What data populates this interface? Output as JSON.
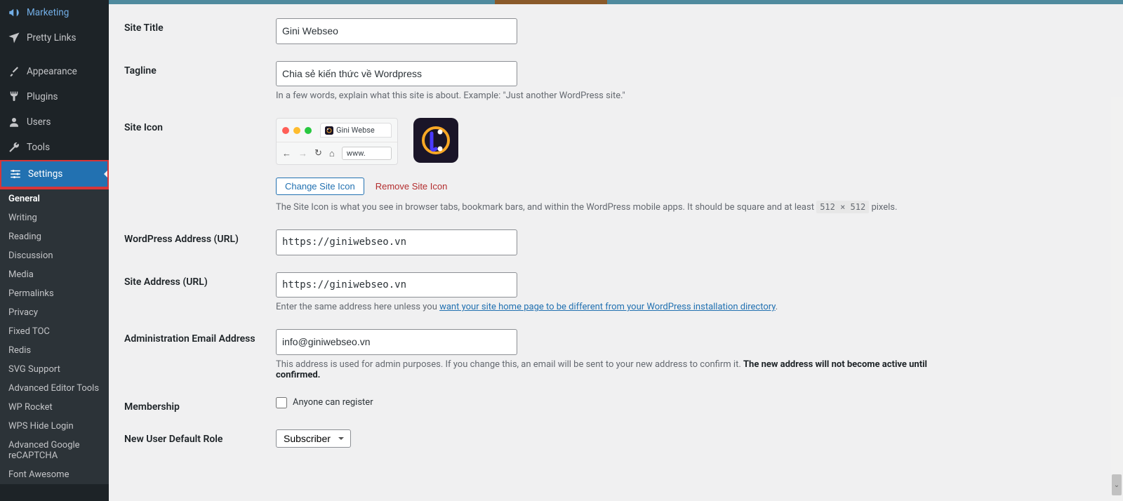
{
  "sidebar": {
    "main": [
      {
        "icon": "megaphone",
        "label": "Marketing"
      },
      {
        "icon": "star",
        "label": "Pretty Links"
      },
      {
        "icon": "brush",
        "label": "Appearance"
      },
      {
        "icon": "plug",
        "label": "Plugins"
      },
      {
        "icon": "user",
        "label": "Users"
      },
      {
        "icon": "wrench",
        "label": "Tools"
      },
      {
        "icon": "sliders",
        "label": "Settings"
      }
    ],
    "sub": [
      "General",
      "Writing",
      "Reading",
      "Discussion",
      "Media",
      "Permalinks",
      "Privacy",
      "Fixed TOC",
      "Redis",
      "SVG Support",
      "Advanced Editor Tools",
      "WP Rocket",
      "WPS Hide Login",
      "Advanced Google reCAPTCHA",
      "Font Awesome"
    ]
  },
  "form": {
    "siteTitle": {
      "label": "Site Title",
      "value": "Gini Webseo"
    },
    "tagline": {
      "label": "Tagline",
      "value": "Chia sẻ kiến thức về Wordpress",
      "desc": "In a few words, explain what this site is about. Example: \"Just another WordPress site.\""
    },
    "siteIcon": {
      "label": "Site Icon",
      "tabText": "Gini Webse",
      "urlText": "www.",
      "changeBtn": "Change Site Icon",
      "removeBtn": "Remove Site Icon",
      "descPre": "The Site Icon is what you see in browser tabs, bookmark bars, and within the WordPress mobile apps. It should be square and at least ",
      "descCode": "512 × 512",
      "descPost": " pixels."
    },
    "wpAddress": {
      "label": "WordPress Address (URL)",
      "value": "https://giniwebseo.vn"
    },
    "siteAddress": {
      "label": "Site Address (URL)",
      "value": "https://giniwebseo.vn",
      "descPre": "Enter the same address here unless you ",
      "descLink": "want your site home page to be different from your WordPress installation directory",
      "descPost": "."
    },
    "adminEmail": {
      "label": "Administration Email Address",
      "value": "info@giniwebseo.vn",
      "descPre": "This address is used for admin purposes. If you change this, an email will be sent to your new address to confirm it. ",
      "descStrong": "The new address will not become active until confirmed."
    },
    "membership": {
      "label": "Membership",
      "checkLabel": "Anyone can register"
    },
    "defaultRole": {
      "label": "New User Default Role",
      "value": "Subscriber"
    }
  }
}
